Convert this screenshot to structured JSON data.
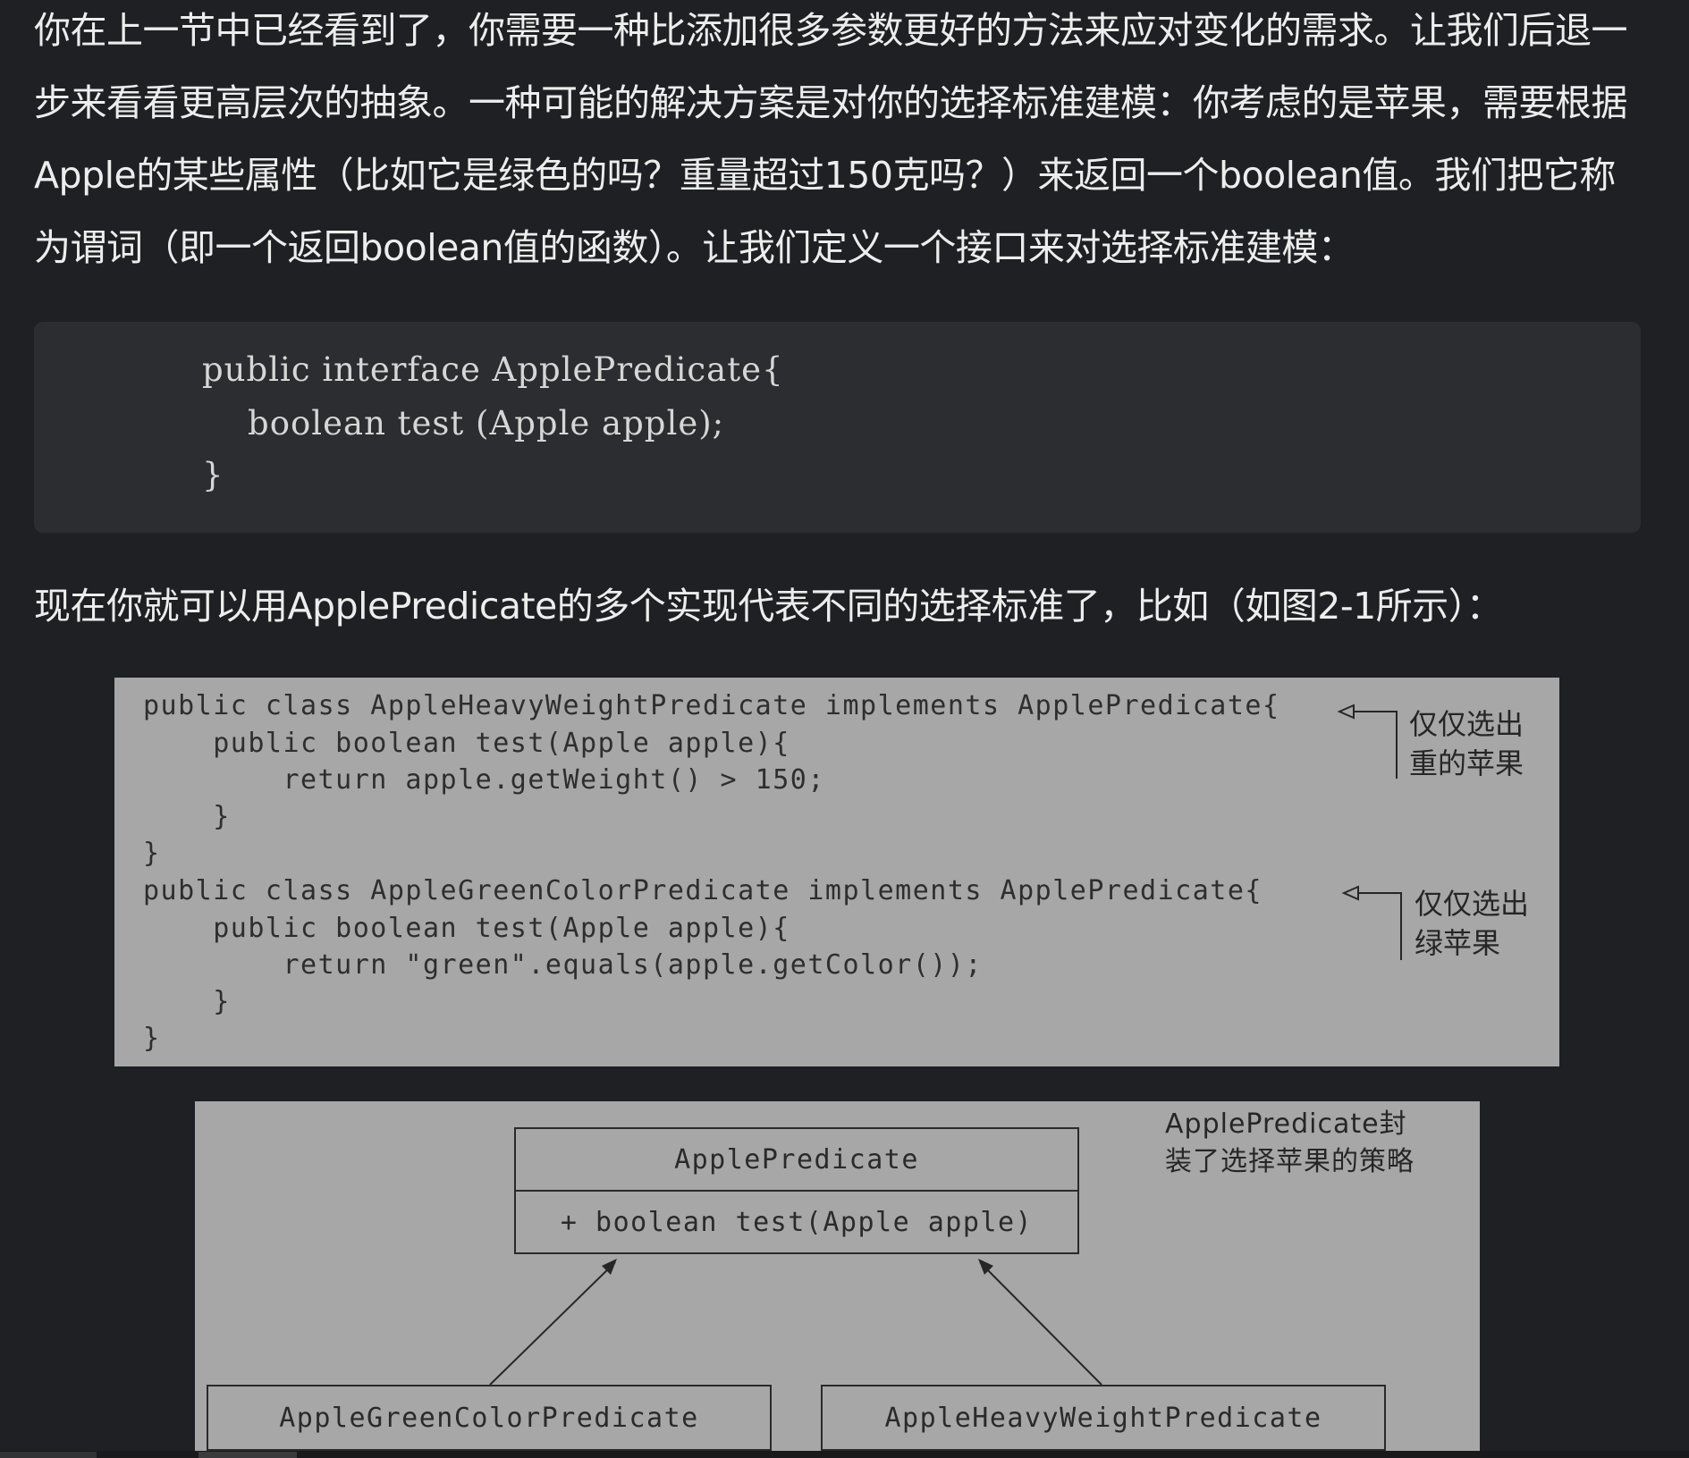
{
  "paragraphs": {
    "p1": "你在上一节中已经看到了，你需要一种比添加很多参数更好的方法来应对变化的需求。让我们后退一步来看看更高层次的抽象。一种可能的解决方案是对你的选择标准建模：你考虑的是苹果，需要根据Apple的某些属性（比如它是绿色的吗？重量超过150克吗？）来返回一个boolean值。我们把它称为谓词（即一个返回boolean值的函数）。让我们定义一个接口来对选择标准建模：",
    "p2": "现在你就可以用ApplePredicate的多个实现代表不同的选择标准了，比如（如图2-1所示）："
  },
  "code_block": {
    "lines": [
      "public interface ApplePredicate{",
      "    boolean test (Apple apple);",
      "}"
    ]
  },
  "figure": {
    "code_lines": [
      "public class AppleHeavyWeightPredicate implements ApplePredicate{",
      "    public boolean test(Apple apple){",
      "        return apple.getWeight() > 150;",
      "    }",
      "}",
      "public class AppleGreenColorPredicate implements ApplePredicate{",
      "    public boolean test(Apple apple){",
      "        return \"green\".equals(apple.getColor());",
      "    }",
      "}"
    ],
    "annotations": {
      "heavy": "仅仅选出\n重的苹果",
      "green": "仅仅选出\n绿苹果"
    },
    "uml": {
      "interface_name": "ApplePredicate",
      "interface_method": "+ boolean test(Apple apple)",
      "impl_left": "AppleGreenColorPredicate",
      "impl_right": "AppleHeavyWeightPredicate",
      "note": "ApplePredicate封\n装了选择苹果的策略"
    }
  }
}
